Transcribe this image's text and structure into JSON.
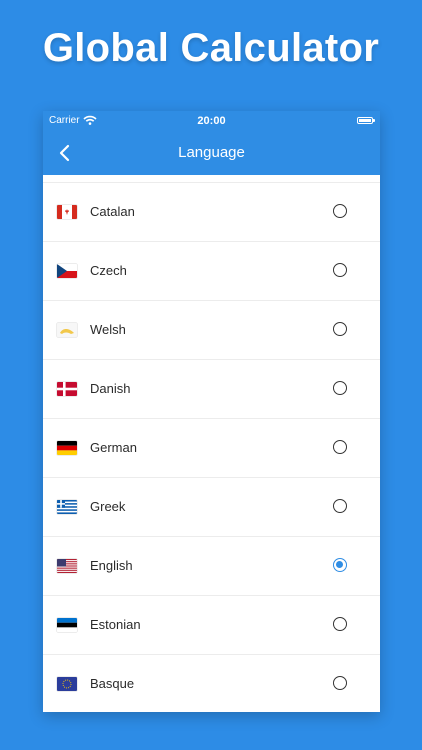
{
  "headline": "Global Calculator",
  "status": {
    "carrier": "Carrier",
    "time": "20:00"
  },
  "nav": {
    "title": "Language",
    "back_icon": "chevron-left-icon"
  },
  "colors": {
    "background": "#2d8ce6",
    "accent": "#2f8de4"
  },
  "languages": [
    {
      "label": "Catalan",
      "flag": "flag-icon-catalan",
      "selected": false
    },
    {
      "label": "Czech",
      "flag": "flag-icon-czech",
      "selected": false
    },
    {
      "label": "Welsh",
      "flag": "flag-icon-welsh",
      "selected": false
    },
    {
      "label": "Danish",
      "flag": "flag-icon-danish",
      "selected": false
    },
    {
      "label": "German",
      "flag": "flag-icon-german",
      "selected": false
    },
    {
      "label": "Greek",
      "flag": "flag-icon-greek",
      "selected": false
    },
    {
      "label": "English",
      "flag": "flag-icon-english",
      "selected": true
    },
    {
      "label": "Estonian",
      "flag": "flag-icon-estonian",
      "selected": false
    },
    {
      "label": "Basque",
      "flag": "flag-icon-basque",
      "selected": false
    }
  ]
}
